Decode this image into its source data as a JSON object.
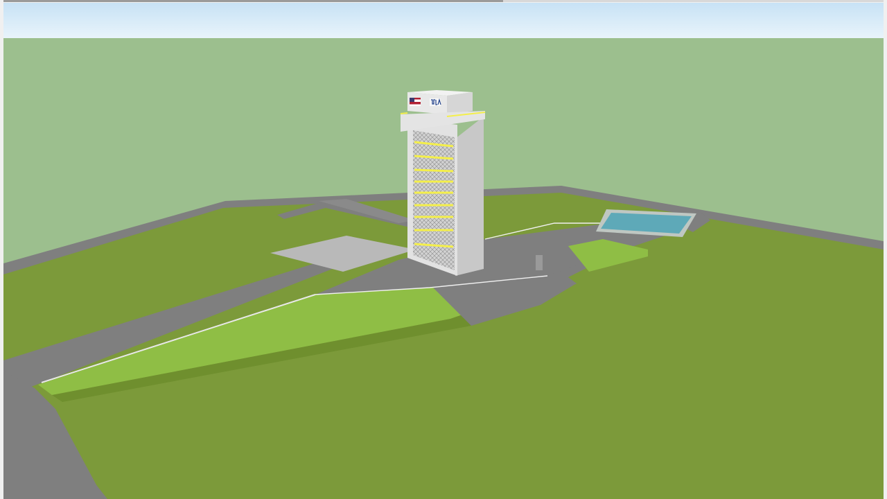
{
  "app": {
    "viewport_label": ""
  },
  "scene": {
    "sky_color": "#cfe7f7",
    "ground_color": "#9cbf8e",
    "grass_color": "#7c9a3a",
    "berm_color": "#8fbe45",
    "road_color": "#7f7f7f",
    "pool_color": "#5ea9b8",
    "tower_color": "#dcdcdc",
    "platform_color": "#f4ef4a"
  },
  "model": {
    "structure": "launch-tower",
    "flag_icon": "us-flag-icon",
    "logo_icon": "ula-logo-icon"
  }
}
